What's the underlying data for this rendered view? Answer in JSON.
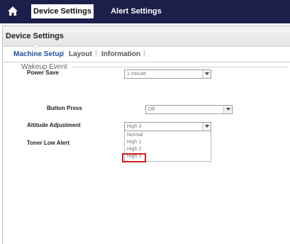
{
  "topnav": {
    "home_icon": "home-icon",
    "tabs": [
      {
        "label": "Device Settings",
        "active": true
      },
      {
        "label": "Alert Settings",
        "active": false
      }
    ]
  },
  "page": {
    "title": "Device Settings",
    "subnav": [
      "Machine Setup",
      "Layout",
      "Information"
    ],
    "active_subnav": "Machine Setup"
  },
  "settings": {
    "power_save": {
      "label": "Power Save",
      "value": "1 minute"
    },
    "wakeup_section": "Wakeup Event",
    "button_press": {
      "label": "Button Press",
      "value": "Off"
    },
    "altitude": {
      "label": "Altitude Adjustment",
      "value": "High 3",
      "options": [
        "Normal",
        "High 1",
        "High 2",
        "High 3"
      ]
    },
    "toner_low_alert": {
      "label": "Toner Low Alert"
    }
  },
  "colors": {
    "nav_bg": "#1b1f4a",
    "active_link": "#1f4fa0",
    "highlight": "#d0201e"
  }
}
